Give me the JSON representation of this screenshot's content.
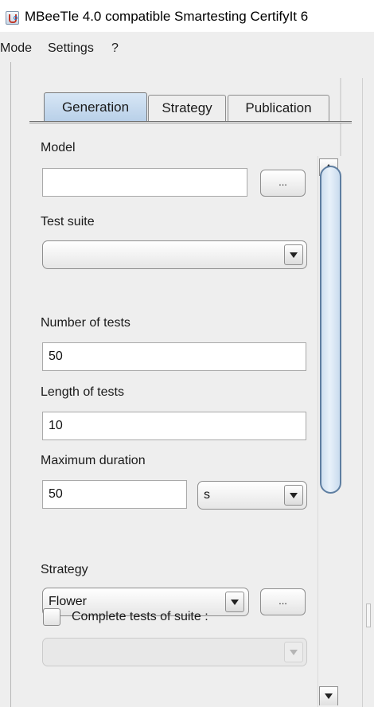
{
  "window": {
    "title": "MBeeTle 4.0 compatible Smartesting CertifyIt 6"
  },
  "menu": {
    "items": [
      "Mode",
      "Settings",
      "?"
    ]
  },
  "tabs": [
    {
      "label": "Generation",
      "active": true
    },
    {
      "label": "Strategy",
      "active": false
    },
    {
      "label": "Publication",
      "active": false
    }
  ],
  "form": {
    "model": {
      "label": "Model",
      "value": "",
      "browse_label": "..."
    },
    "test_suite": {
      "label": "Test suite",
      "value": ""
    },
    "number_of_tests": {
      "label": "Number of tests",
      "value": "50"
    },
    "length_of_tests": {
      "label": "Length of tests",
      "value": "10"
    },
    "maximum_duration": {
      "label": "Maximum duration",
      "value": "50",
      "unit": "s"
    },
    "strategy": {
      "label": "Strategy",
      "value": "Flower",
      "options_label": "..."
    },
    "complete_tests": {
      "label": "Complete tests of suite :",
      "checked": false
    },
    "suite_select": {
      "value": "",
      "enabled": false
    }
  },
  "icons": [
    "app-icon",
    "dropdown-arrow-icon",
    "scroll-up-icon",
    "scroll-down-icon"
  ],
  "colors": {
    "active_tab": "#c6dbf0",
    "scroll_thumb_border": "#5e7ea1",
    "panel_background": "#eeeeee"
  }
}
